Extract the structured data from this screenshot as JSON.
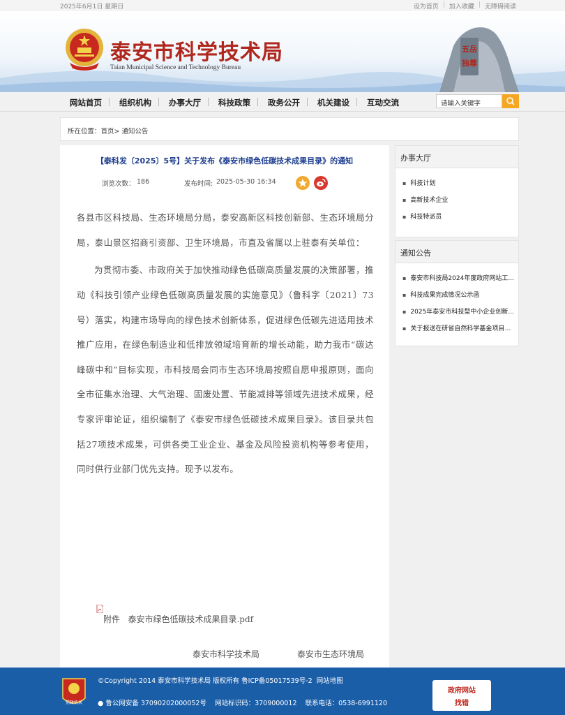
{
  "topbar": {
    "date": "2025年6月1日 星期日",
    "set_home": "设为首页",
    "add_favorite": "加入收藏",
    "accessible": "无障碍阅读",
    "separator": "|"
  },
  "header": {
    "title": "泰安市科学技术局",
    "subtitle": "Taian Municipal Science and Technology Bureau",
    "mountain_text": "五岳独尊"
  },
  "nav": {
    "items": [
      "网站首页",
      "组织机构",
      "办事大厅",
      "科技政策",
      "政务公开",
      "机关建设",
      "互动交流"
    ],
    "search_placeholder": "请输入关键字"
  },
  "breadcrumb": {
    "label": "所在位置：",
    "home": "首页",
    "sep": "> ",
    "current": "通知公告"
  },
  "article": {
    "title": "【泰科发〔2025〕5号】关于发布《泰安市绿色低碳技术成果目录》的通知",
    "views_label": "浏览次数：",
    "views": "186",
    "published_label": "发布时间:",
    "published": "2025-05-30 16:34",
    "salutation": "各县市区科技局、生态环境局分局，泰安高新区科技创新部、生态环境局分局，泰山景区招商引资部、卫生环境局，市直及省属以上驻泰有关单位：",
    "paragraph": "为贯彻市委、市政府关于加快推动绿色低碳高质量发展的决策部署，推动《科技引领产业绿色低碳高质量发展的实施意见》（鲁科字〔2021〕73号）落实，构建市场导向的绿色技术创新体系，促进绿色低碳先进适用技术推广应用，在绿色制造业和低排放领域培育新的增长动能，助力我市“碳达峰碳中和”目标实现，市科技局会同市生态环境局按照自愿申报原则，面向全市征集水治理、大气治理、固废处置、节能减排等领域先进技术成果，经专家评审论证，组织编制了《泰安市绿色低碳技术成果目录》。该目录共包括27项技术成果，可供各类工业企业、基金及风险投资机构等参考使用，同时供行业部门优先支持。现予以发布。",
    "attachment_label": "附件",
    "attachment": "泰安市绿色低碳技术成果目录.pdf",
    "signer1": "泰安市科学技术局",
    "signer2": "泰安市生态环境局"
  },
  "sidebar": {
    "service": {
      "title": "办事大厅",
      "items": [
        "科技计划",
        "高新技术企业",
        "科技特派员"
      ]
    },
    "notices": {
      "title": "通知公告",
      "items": [
        "泰安市科技局2024年度政府网站工...",
        "科技成果完成情况公示函",
        "2025年泰安市科技型中小企业创新...",
        "关于报送在研省自然科学基金项目执行..."
      ]
    }
  },
  "footer": {
    "copyright": "©Copyright 2014 泰安市科学技术局 版权所有 鲁ICP备05017539号-2",
    "sitemap": "网站地图",
    "police": "鲁公网安备 37090202000052号",
    "site_code": "网站标识码：3709000012",
    "phone": "联系电话：0538-6991120",
    "badge_text": "党政机关",
    "gov_t1": "政府网站",
    "gov_t2": "找错"
  },
  "colors": {
    "title_red": "#b0271d",
    "link_blue": "#1f3f8f",
    "footer_blue": "#1b5ea8",
    "search_orange": "#f5a623"
  }
}
